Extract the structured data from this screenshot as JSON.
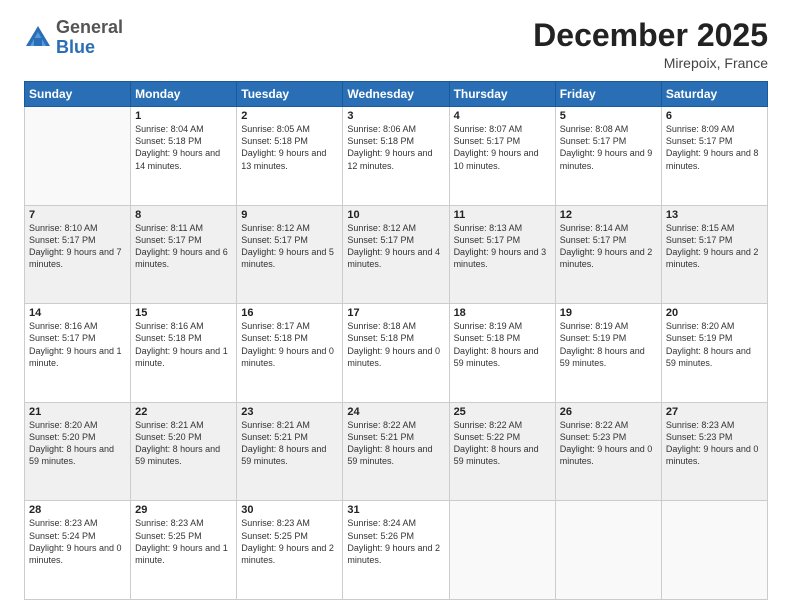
{
  "logo": {
    "general": "General",
    "blue": "Blue"
  },
  "header": {
    "month": "December 2025",
    "location": "Mirepoix, France"
  },
  "days_of_week": [
    "Sunday",
    "Monday",
    "Tuesday",
    "Wednesday",
    "Thursday",
    "Friday",
    "Saturday"
  ],
  "weeks": [
    [
      {
        "day": "",
        "sunrise": "",
        "sunset": "",
        "daylight": ""
      },
      {
        "day": "1",
        "sunrise": "Sunrise: 8:04 AM",
        "sunset": "Sunset: 5:18 PM",
        "daylight": "Daylight: 9 hours and 14 minutes."
      },
      {
        "day": "2",
        "sunrise": "Sunrise: 8:05 AM",
        "sunset": "Sunset: 5:18 PM",
        "daylight": "Daylight: 9 hours and 13 minutes."
      },
      {
        "day": "3",
        "sunrise": "Sunrise: 8:06 AM",
        "sunset": "Sunset: 5:18 PM",
        "daylight": "Daylight: 9 hours and 12 minutes."
      },
      {
        "day": "4",
        "sunrise": "Sunrise: 8:07 AM",
        "sunset": "Sunset: 5:17 PM",
        "daylight": "Daylight: 9 hours and 10 minutes."
      },
      {
        "day": "5",
        "sunrise": "Sunrise: 8:08 AM",
        "sunset": "Sunset: 5:17 PM",
        "daylight": "Daylight: 9 hours and 9 minutes."
      },
      {
        "day": "6",
        "sunrise": "Sunrise: 8:09 AM",
        "sunset": "Sunset: 5:17 PM",
        "daylight": "Daylight: 9 hours and 8 minutes."
      }
    ],
    [
      {
        "day": "7",
        "sunrise": "Sunrise: 8:10 AM",
        "sunset": "Sunset: 5:17 PM",
        "daylight": "Daylight: 9 hours and 7 minutes."
      },
      {
        "day": "8",
        "sunrise": "Sunrise: 8:11 AM",
        "sunset": "Sunset: 5:17 PM",
        "daylight": "Daylight: 9 hours and 6 minutes."
      },
      {
        "day": "9",
        "sunrise": "Sunrise: 8:12 AM",
        "sunset": "Sunset: 5:17 PM",
        "daylight": "Daylight: 9 hours and 5 minutes."
      },
      {
        "day": "10",
        "sunrise": "Sunrise: 8:12 AM",
        "sunset": "Sunset: 5:17 PM",
        "daylight": "Daylight: 9 hours and 4 minutes."
      },
      {
        "day": "11",
        "sunrise": "Sunrise: 8:13 AM",
        "sunset": "Sunset: 5:17 PM",
        "daylight": "Daylight: 9 hours and 3 minutes."
      },
      {
        "day": "12",
        "sunrise": "Sunrise: 8:14 AM",
        "sunset": "Sunset: 5:17 PM",
        "daylight": "Daylight: 9 hours and 2 minutes."
      },
      {
        "day": "13",
        "sunrise": "Sunrise: 8:15 AM",
        "sunset": "Sunset: 5:17 PM",
        "daylight": "Daylight: 9 hours and 2 minutes."
      }
    ],
    [
      {
        "day": "14",
        "sunrise": "Sunrise: 8:16 AM",
        "sunset": "Sunset: 5:17 PM",
        "daylight": "Daylight: 9 hours and 1 minute."
      },
      {
        "day": "15",
        "sunrise": "Sunrise: 8:16 AM",
        "sunset": "Sunset: 5:18 PM",
        "daylight": "Daylight: 9 hours and 1 minute."
      },
      {
        "day": "16",
        "sunrise": "Sunrise: 8:17 AM",
        "sunset": "Sunset: 5:18 PM",
        "daylight": "Daylight: 9 hours and 0 minutes."
      },
      {
        "day": "17",
        "sunrise": "Sunrise: 8:18 AM",
        "sunset": "Sunset: 5:18 PM",
        "daylight": "Daylight: 9 hours and 0 minutes."
      },
      {
        "day": "18",
        "sunrise": "Sunrise: 8:19 AM",
        "sunset": "Sunset: 5:18 PM",
        "daylight": "Daylight: 8 hours and 59 minutes."
      },
      {
        "day": "19",
        "sunrise": "Sunrise: 8:19 AM",
        "sunset": "Sunset: 5:19 PM",
        "daylight": "Daylight: 8 hours and 59 minutes."
      },
      {
        "day": "20",
        "sunrise": "Sunrise: 8:20 AM",
        "sunset": "Sunset: 5:19 PM",
        "daylight": "Daylight: 8 hours and 59 minutes."
      }
    ],
    [
      {
        "day": "21",
        "sunrise": "Sunrise: 8:20 AM",
        "sunset": "Sunset: 5:20 PM",
        "daylight": "Daylight: 8 hours and 59 minutes."
      },
      {
        "day": "22",
        "sunrise": "Sunrise: 8:21 AM",
        "sunset": "Sunset: 5:20 PM",
        "daylight": "Daylight: 8 hours and 59 minutes."
      },
      {
        "day": "23",
        "sunrise": "Sunrise: 8:21 AM",
        "sunset": "Sunset: 5:21 PM",
        "daylight": "Daylight: 8 hours and 59 minutes."
      },
      {
        "day": "24",
        "sunrise": "Sunrise: 8:22 AM",
        "sunset": "Sunset: 5:21 PM",
        "daylight": "Daylight: 8 hours and 59 minutes."
      },
      {
        "day": "25",
        "sunrise": "Sunrise: 8:22 AM",
        "sunset": "Sunset: 5:22 PM",
        "daylight": "Daylight: 8 hours and 59 minutes."
      },
      {
        "day": "26",
        "sunrise": "Sunrise: 8:22 AM",
        "sunset": "Sunset: 5:23 PM",
        "daylight": "Daylight: 9 hours and 0 minutes."
      },
      {
        "day": "27",
        "sunrise": "Sunrise: 8:23 AM",
        "sunset": "Sunset: 5:23 PM",
        "daylight": "Daylight: 9 hours and 0 minutes."
      }
    ],
    [
      {
        "day": "28",
        "sunrise": "Sunrise: 8:23 AM",
        "sunset": "Sunset: 5:24 PM",
        "daylight": "Daylight: 9 hours and 0 minutes."
      },
      {
        "day": "29",
        "sunrise": "Sunrise: 8:23 AM",
        "sunset": "Sunset: 5:25 PM",
        "daylight": "Daylight: 9 hours and 1 minute."
      },
      {
        "day": "30",
        "sunrise": "Sunrise: 8:23 AM",
        "sunset": "Sunset: 5:25 PM",
        "daylight": "Daylight: 9 hours and 2 minutes."
      },
      {
        "day": "31",
        "sunrise": "Sunrise: 8:24 AM",
        "sunset": "Sunset: 5:26 PM",
        "daylight": "Daylight: 9 hours and 2 minutes."
      },
      {
        "day": "",
        "sunrise": "",
        "sunset": "",
        "daylight": ""
      },
      {
        "day": "",
        "sunrise": "",
        "sunset": "",
        "daylight": ""
      },
      {
        "day": "",
        "sunrise": "",
        "sunset": "",
        "daylight": ""
      }
    ]
  ]
}
